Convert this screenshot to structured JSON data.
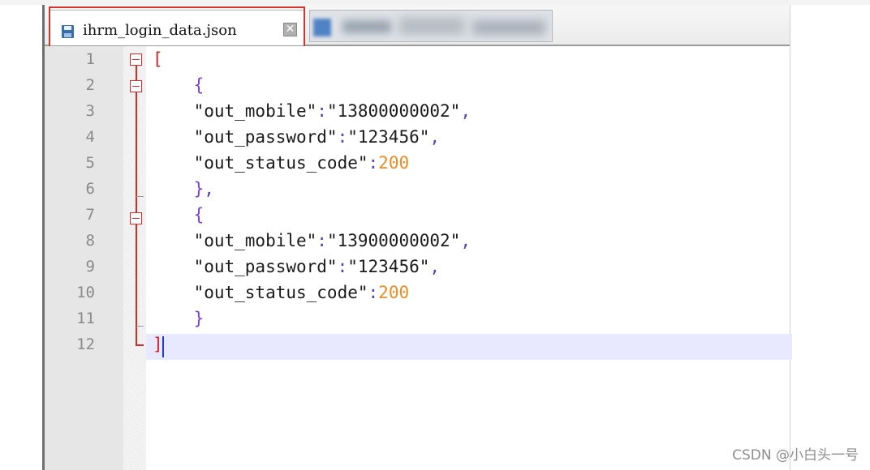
{
  "tabs": [
    {
      "label": "ihrm_login_data.json",
      "active": true,
      "icon": "save-icon",
      "close_glyph": "✕"
    },
    {
      "label": "",
      "active": false,
      "icon": "file-icon",
      "blurred": true
    }
  ],
  "editor": {
    "lines": [
      {
        "n": "1",
        "tokens": [
          {
            "t": "[",
            "c": "bracket"
          }
        ]
      },
      {
        "n": "2",
        "tokens": [
          {
            "t": "    {",
            "c": "brace"
          }
        ]
      },
      {
        "n": "3",
        "tokens": [
          {
            "t": "    \"out_mobile\"",
            "c": "str"
          },
          {
            "t": ":",
            "c": "punct"
          },
          {
            "t": "\"13800000002\"",
            "c": "str"
          },
          {
            "t": ",",
            "c": "punct"
          }
        ]
      },
      {
        "n": "4",
        "tokens": [
          {
            "t": "    \"out_password\"",
            "c": "str"
          },
          {
            "t": ":",
            "c": "punct"
          },
          {
            "t": "\"123456\"",
            "c": "str"
          },
          {
            "t": ",",
            "c": "punct"
          }
        ]
      },
      {
        "n": "5",
        "tokens": [
          {
            "t": "    \"out_status_code\"",
            "c": "str"
          },
          {
            "t": ":",
            "c": "punct"
          },
          {
            "t": "200",
            "c": "num"
          }
        ]
      },
      {
        "n": "6",
        "tokens": [
          {
            "t": "    }",
            "c": "brace"
          },
          {
            "t": ",",
            "c": "punct"
          }
        ]
      },
      {
        "n": "7",
        "tokens": [
          {
            "t": "    {",
            "c": "brace"
          }
        ]
      },
      {
        "n": "8",
        "tokens": [
          {
            "t": "    \"out_mobile\"",
            "c": "str"
          },
          {
            "t": ":",
            "c": "punct"
          },
          {
            "t": "\"13900000002\"",
            "c": "str"
          },
          {
            "t": ",",
            "c": "punct"
          }
        ]
      },
      {
        "n": "9",
        "tokens": [
          {
            "t": "    \"out_password\"",
            "c": "str"
          },
          {
            "t": ":",
            "c": "punct"
          },
          {
            "t": "\"123456\"",
            "c": "str"
          },
          {
            "t": ",",
            "c": "punct"
          }
        ]
      },
      {
        "n": "10",
        "tokens": [
          {
            "t": "    \"out_status_code\"",
            "c": "str"
          },
          {
            "t": ":",
            "c": "punct"
          },
          {
            "t": "200",
            "c": "num"
          }
        ]
      },
      {
        "n": "11",
        "tokens": [
          {
            "t": "    }",
            "c": "brace"
          }
        ]
      },
      {
        "n": "12",
        "tokens": [
          {
            "t": "]",
            "c": "bracket"
          }
        ]
      }
    ],
    "current_line": "12"
  },
  "watermark": "CSDN @小白头一号",
  "colors": {
    "highlight_border": "#d9342b",
    "bracket": "#e02020",
    "brace": "#7b3fd1",
    "number": "#f28b20",
    "current_line_bg": "#e8e8ff"
  }
}
